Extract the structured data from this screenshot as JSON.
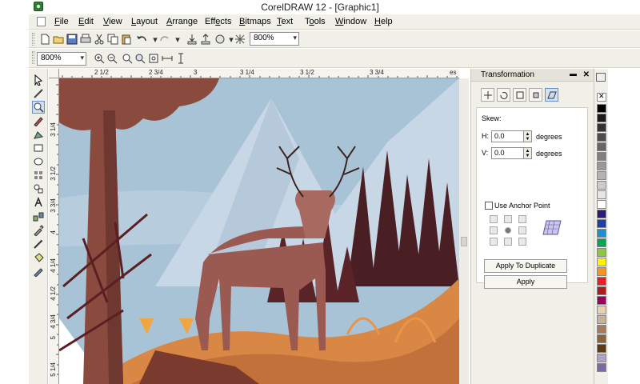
{
  "window": {
    "title": "CorelDRAW 12 - [Graphic1]"
  },
  "menu": [
    {
      "label": "File",
      "ul": "F"
    },
    {
      "label": "Edit",
      "ul": "E"
    },
    {
      "label": "View",
      "ul": "V"
    },
    {
      "label": "Layout",
      "ul": "L"
    },
    {
      "label": "Arrange",
      "ul": "A"
    },
    {
      "label": "Effects",
      "ul": "E"
    },
    {
      "label": "Bitmaps",
      "ul": "B"
    },
    {
      "label": "Text",
      "ul": "T"
    },
    {
      "label": "Tools",
      "ul": "o"
    },
    {
      "label": "Window",
      "ul": "W"
    },
    {
      "label": "Help",
      "ul": "H"
    }
  ],
  "toolbar": {
    "zoom_level": "800%"
  },
  "zoom_toolbar": {
    "zoom_level": "800%"
  },
  "rulers": {
    "horizontal": [
      "2 1/2",
      "2 3/4",
      "3",
      "3 1/4",
      "3 1/2",
      "3 3/4",
      "es"
    ],
    "vertical": [
      "3 1/4",
      "3 1/2",
      "3 3/4",
      "4",
      "4 1/4",
      "4 1/2",
      "4 3/4",
      "5",
      "5 1/4"
    ]
  },
  "docker": {
    "title": "Transformation",
    "skew_label": "Skew:",
    "h_label": "H:",
    "h_value": "0.0",
    "v_label": "V:",
    "v_value": "0.0",
    "unit": "degrees",
    "anchor_label": "Use Anchor Point",
    "apply_duplicate": "Apply To Duplicate",
    "apply": "Apply"
  },
  "palette_colors": [
    "#000000",
    "#1a1a1a",
    "#333333",
    "#4d4d4d",
    "#666666",
    "#808080",
    "#999999",
    "#b3b3b3",
    "#cccccc",
    "#e6e6e6",
    "#ffffff",
    "#2e1a7a",
    "#1e3fa8",
    "#1a8fd6",
    "#00a651",
    "#8dc63f",
    "#fff200",
    "#f7941d",
    "#ed1c24",
    "#b31b1b",
    "#9e005d",
    "#e8d3ad",
    "#c7b299",
    "#a87c5a",
    "#8c6239",
    "#603913",
    "#b3a2c7",
    "#7b69a6"
  ],
  "canvas_colors": {
    "sky": "#a9c3d6",
    "mountain": "#c3d3e3",
    "tree_trunk": "#8a4a3e",
    "deer": "#9a5a52",
    "ground": "#d98744",
    "dark_trees": "#4a1f24"
  }
}
